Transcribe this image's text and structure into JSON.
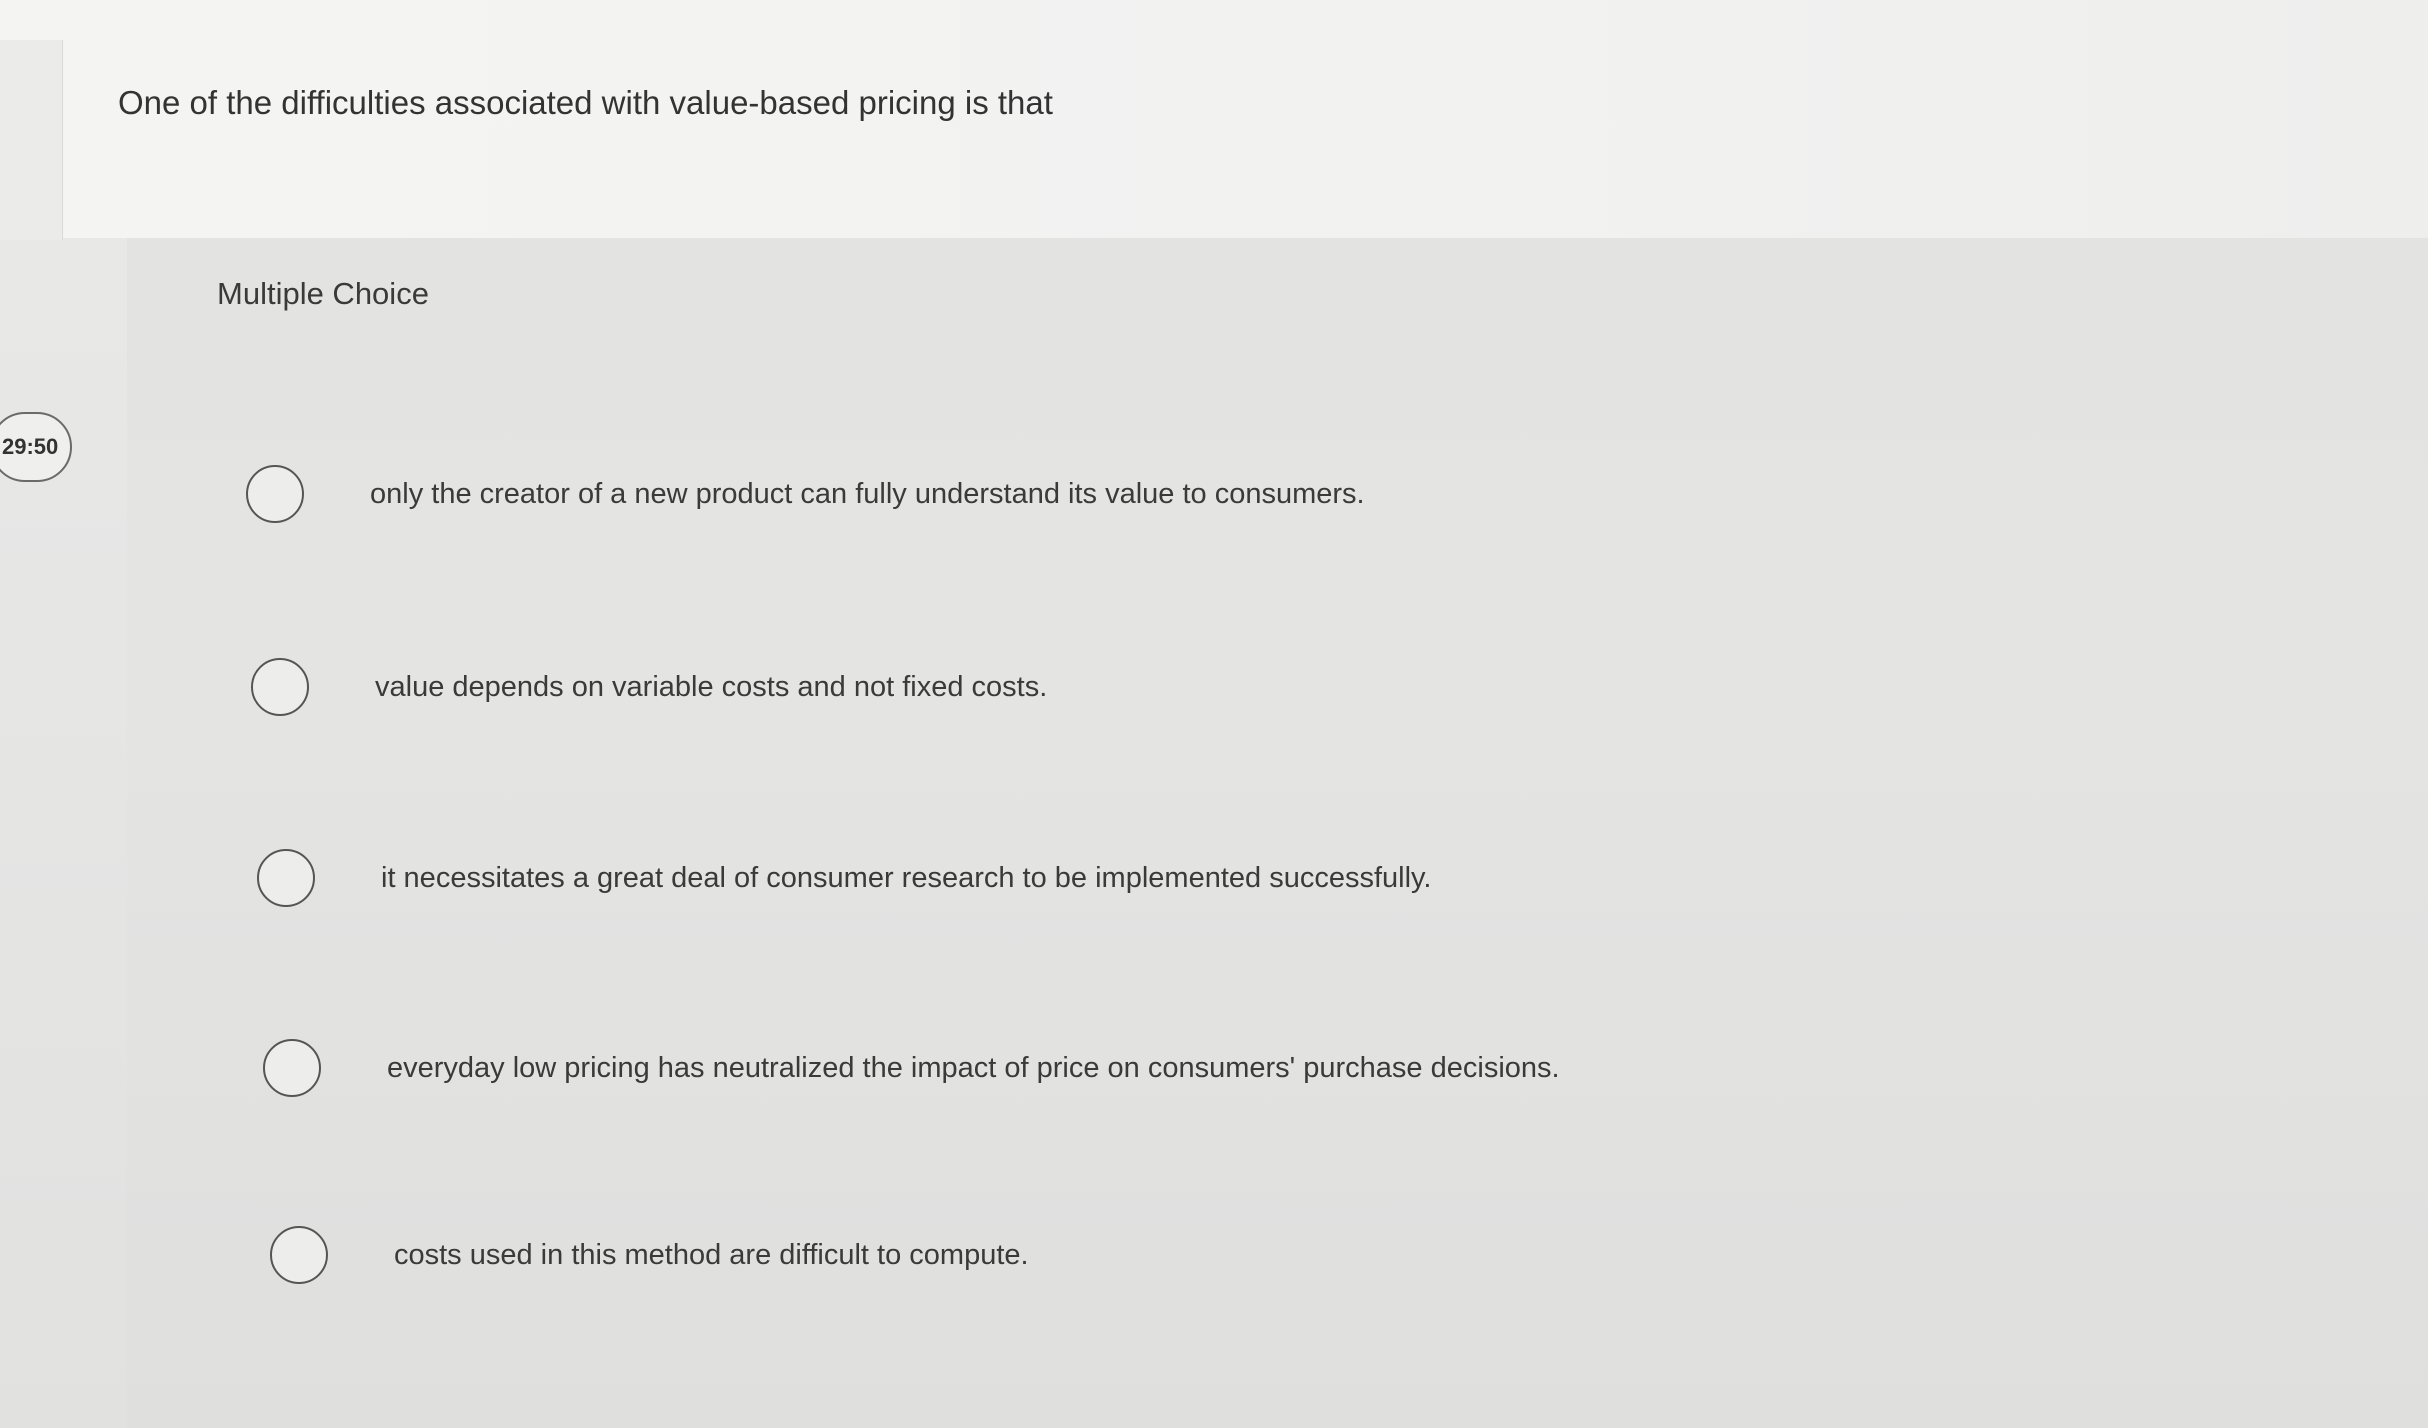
{
  "question": {
    "text": "One of the difficulties associated with value-based pricing is that"
  },
  "question_type": "Multiple Choice",
  "timer": "29:50",
  "options": [
    {
      "label": "only the creator of a new product can fully understand its value to consumers.",
      "selected": false
    },
    {
      "label": "value depends on variable costs and not fixed costs.",
      "selected": false
    },
    {
      "label": "it necessitates a great deal of consumer research to be implemented successfully.",
      "selected": false
    },
    {
      "label": "everyday low pricing has neutralized the impact of price on consumers' purchase decisions.",
      "selected": false
    },
    {
      "label": "costs used in this method are difficult to compute.",
      "selected": false
    }
  ]
}
